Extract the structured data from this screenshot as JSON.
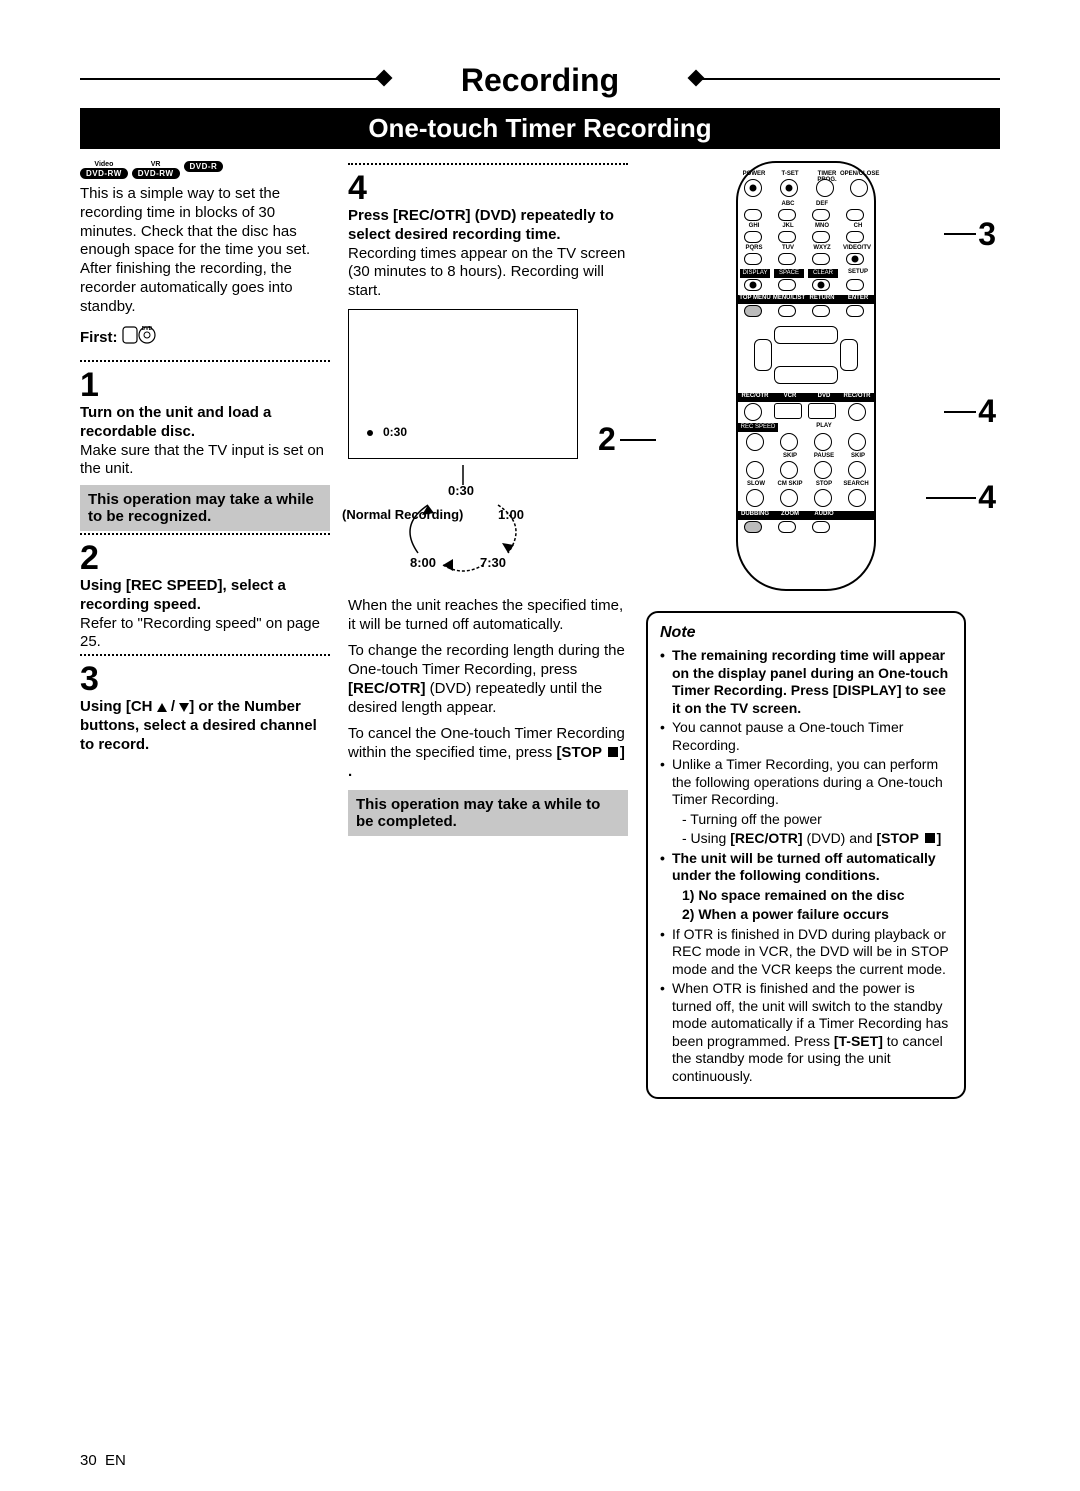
{
  "title": "Recording",
  "section": "One-touch Timer Recording",
  "disc_badges": [
    {
      "top": "Video",
      "pill": "DVD-RW"
    },
    {
      "top": "VR",
      "pill": "DVD-RW"
    },
    {
      "top": "",
      "pill": "DVD-R"
    }
  ],
  "intro": "This is a simple way to set the recording time in blocks of 30 minutes. Check that the disc has enough space for the time you set. After finishing the recording, the recorder automatically goes into standby.",
  "first_label": "First:",
  "steps": {
    "s1": {
      "num": "1",
      "head": "Turn on the unit and load a recordable disc.",
      "body": "Make sure that the TV input is set on the unit.",
      "notice": "This operation may take a while to be recognized."
    },
    "s2": {
      "num": "2",
      "head": "Using [REC SPEED], select a recording speed.",
      "body": "Refer to \"Recording speed\" on page 25."
    },
    "s3": {
      "num": "3",
      "head": "Using [CH ▲ / ▼] or the Number buttons, select a desired channel to record."
    },
    "s4": {
      "num": "4",
      "head": "Press [REC/OTR] (DVD) repeatedly to select desired recording time.",
      "body": "Recording times appear on the TV screen (30 minutes to 8 hours). Recording will start."
    }
  },
  "tv_screen": {
    "indicator": "0:30"
  },
  "cycle": {
    "top": "0:30",
    "left_label": "(Normal Recording)",
    "right": "1:00",
    "bottom_left": "8:00",
    "bottom_right": "7:30"
  },
  "midtext1": "When the unit reaches the specified time, it will be turned off automatically.",
  "midtext2_a": "To change the recording length during the One-touch Timer Recording, press ",
  "midtext2_b": "[REC/OTR]",
  "midtext2_c": " (DVD) repeatedly until the desired length appear.",
  "midtext3_a": "To cancel the One-touch Timer Recording within the specified time, press ",
  "midtext3_b": "[STOP ",
  "midtext3_c": "] .",
  "notice2": "This operation may take a while to be completed.",
  "note": {
    "title": "Note",
    "items": [
      {
        "bold": true,
        "text": "The remaining recording time will appear on the display panel during an One-touch Timer Recording. Press [DISPLAY] to see it on the TV screen."
      },
      {
        "bold": false,
        "text": "You cannot pause a One-touch Timer Recording."
      },
      {
        "bold": false,
        "text": "Unlike a Timer Recording, you can perform the following operations during a One-touch Timer Recording.",
        "subs": [
          "- Turning off the power",
          "- Using [REC/OTR] (DVD) and [STOP ■]"
        ]
      },
      {
        "bold": true,
        "text": "The unit will be turned off automatically under the following conditions.",
        "bold_subs": [
          "1) No space remained on the disc",
          "2) When a power failure occurs"
        ]
      },
      {
        "bold": false,
        "text": "If OTR is finished in DVD during playback or REC mode in VCR, the DVD will be in STOP mode and the VCR keeps the current mode."
      },
      {
        "bold": false,
        "text": "When OTR is finished and the power is turned off, the unit will switch to the standby mode automatically if a Timer Recording has been programmed. Press [T-SET] to cancel the standby mode for using the unit continuously."
      }
    ]
  },
  "remote_labels": {
    "power": "POWER",
    "tset": "T-SET",
    "timer": "TIMER PROG.",
    "open": "OPEN/CLOSE",
    "abc": "ABC",
    "def": "DEF",
    "ghi": "GHI",
    "jkl": "JKL",
    "mno": "MNO",
    "ch": "CH",
    "pqrs": "PQRS",
    "tuv": "TUV",
    "wxyz": "WXYZ",
    "video": "VIDEO/TV",
    "display": "DISPLAY",
    "space": "SPACE",
    "clear": "CLEAR",
    "setup": "SETUP",
    "topmenu": "TOP MENU",
    "menu": "MENU/LIST",
    "return": "RETURN",
    "enter": "ENTER",
    "recotr": "REC/OTR",
    "vcr": "VCR",
    "dvd": "DVD",
    "recspeed": "REC SPEED",
    "play": "PLAY",
    "skip": "SKIP",
    "pause": "PAUSE",
    "slow": "SLOW",
    "cmskip": "CM SKIP",
    "stop": "STOP",
    "search": "SEARCH",
    "dubbing": "DUBBING",
    "zoom": "ZOOM",
    "audio": "AUDIO"
  },
  "callouts": {
    "c2": "2",
    "c3": "3",
    "c4a": "4",
    "c4b": "4"
  },
  "page_number": "30",
  "page_lang": "EN"
}
